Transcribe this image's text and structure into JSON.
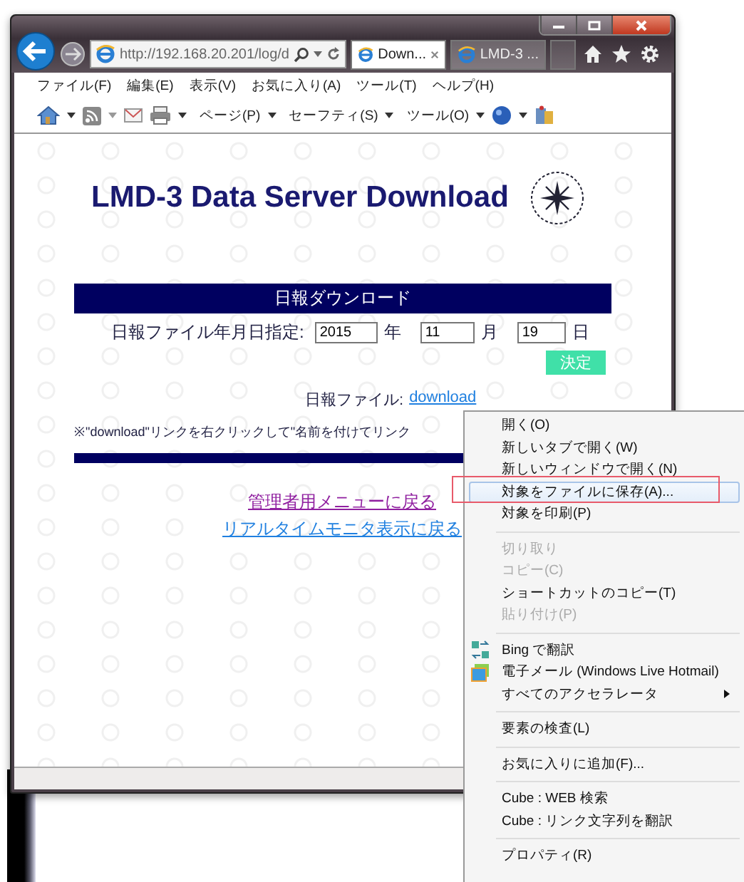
{
  "browser": {
    "address": "http://192.168.20.201/log/d",
    "tabs": [
      {
        "label": "Down...",
        "selected": true
      },
      {
        "label": "LMD-3 ...",
        "selected": false
      }
    ],
    "menu_bar": [
      "ファイル(F)",
      "編集(E)",
      "表示(V)",
      "お気に入り(A)",
      "ツール(T)",
      "ヘルプ(H)"
    ],
    "command_bar": [
      "ページ(P)",
      "セーフティ(S)",
      "ツール(O)"
    ]
  },
  "page": {
    "title": "LMD-3 Data Server Download",
    "section_header": "日報ダウンロード",
    "date_form": {
      "label": "日報ファイル年月日指定:",
      "fields": [
        {
          "value": "2015",
          "unit": "年"
        },
        {
          "value": "11",
          "unit": "月"
        },
        {
          "value": "19",
          "unit": "日"
        }
      ],
      "submit": "決定"
    },
    "file_label": "日報ファイル:",
    "file_link": "download",
    "note": "※\"download\"リンクを右クリックして\"名前を付けてリンク",
    "links": [
      {
        "label": "管理者用メニューに戻る",
        "visited": true
      },
      {
        "label": "リアルタイムモニタ表示に戻る",
        "visited": false
      }
    ]
  },
  "context_menu": {
    "items": [
      {
        "kind": "item",
        "label": "開く(O)",
        "disabled": false,
        "selected": false
      },
      {
        "kind": "item",
        "label": "新しいタブで開く(W)",
        "disabled": false,
        "selected": false
      },
      {
        "kind": "item",
        "label": "新しいウィンドウで開く(N)",
        "disabled": false,
        "selected": false
      },
      {
        "kind": "item",
        "label": "対象をファイルに保存(A)...",
        "disabled": false,
        "selected": true,
        "marked": true
      },
      {
        "kind": "item",
        "label": "対象を印刷(P)",
        "disabled": false,
        "selected": false
      },
      {
        "kind": "separator"
      },
      {
        "kind": "item",
        "label": "切り取り",
        "disabled": true,
        "selected": false
      },
      {
        "kind": "item",
        "label": "コピー(C)",
        "disabled": true,
        "selected": false
      },
      {
        "kind": "item",
        "label": "ショートカットのコピー(T)",
        "disabled": false,
        "selected": false
      },
      {
        "kind": "item",
        "label": "貼り付け(P)",
        "disabled": true,
        "selected": false
      },
      {
        "kind": "separator"
      },
      {
        "kind": "translate",
        "label": "Bing で翻訳",
        "disabled": false,
        "selected": false
      },
      {
        "kind": "mail",
        "label": "電子メール (Windows Live Hotmail)",
        "disabled": false,
        "selected": false
      },
      {
        "kind": "item",
        "label": "すべてのアクセラレータ",
        "disabled": false,
        "selected": false,
        "submenu": true
      },
      {
        "kind": "separator"
      },
      {
        "kind": "item",
        "label": "要素の検査(L)",
        "disabled": false,
        "selected": false
      },
      {
        "kind": "separator"
      },
      {
        "kind": "item",
        "label": "お気に入りに追加(F)...",
        "disabled": false,
        "selected": false
      },
      {
        "kind": "separator"
      },
      {
        "kind": "item",
        "label": "Cube : WEB 検索",
        "disabled": false,
        "selected": false
      },
      {
        "kind": "item",
        "label": "Cube : リンク文字列を翻訳",
        "disabled": false,
        "selected": false
      },
      {
        "kind": "separator"
      },
      {
        "kind": "item",
        "label": "プロパティ(R)",
        "disabled": false,
        "selected": false
      }
    ]
  }
}
